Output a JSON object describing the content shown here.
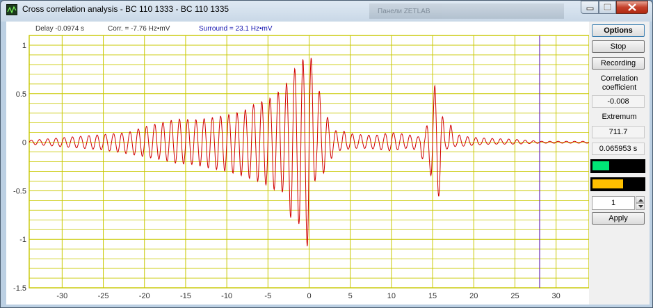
{
  "window": {
    "title": "Cross correlation analysis - BC 110 1333 - BC 110 1335",
    "background_tab": "Панели ZETLAB"
  },
  "status": {
    "delay": "Delay -0.0974 s",
    "corr": "Corr. = -7.76 Hz•mV",
    "surround": "Surround = 23.1 Hz•mV"
  },
  "side_panel": {
    "options": "Options",
    "stop": "Stop",
    "recording": "Recording",
    "corr_label": "Correlation coefficient",
    "corr_value": "-0.008",
    "extremum_label": "Extremum",
    "extremum_value": "711.7",
    "time_value": "0.065953 s",
    "indicator_green_level": 0.33,
    "indicator_yellow_level": 0.6,
    "stepper_value": "1",
    "apply": "Apply"
  },
  "colors": {
    "grid": "#c8c800",
    "signal": "#d00000",
    "cursor": "#6a2bb8",
    "indicator_green": "#00e676",
    "indicator_yellow": "#ffc000"
  },
  "icons": {
    "app": "oscilloscope-icon",
    "minimize": "minimize-icon",
    "maximize": "maximize-icon",
    "close": "close-icon"
  },
  "chart_data": {
    "type": "line",
    "title": "",
    "xlabel": "",
    "ylabel": "",
    "xlim": [
      -34,
      34
    ],
    "ylim": [
      -1.5,
      1.1
    ],
    "x_ticks": [
      -30,
      -25,
      -20,
      -15,
      -10,
      -5,
      0,
      5,
      10,
      15,
      20,
      25,
      30
    ],
    "y_ticks": [
      1,
      0.5,
      0,
      -0.5,
      -1,
      -1.5
    ],
    "cursor_x": 28,
    "grid": true,
    "series": [
      {
        "x": [
          -34,
          -31,
          -28,
          -25,
          -22,
          -20,
          -18,
          -16,
          -14,
          -12,
          -10,
          -8,
          -7,
          -6,
          -5,
          -4,
          -3,
          -2.5,
          -2,
          -1.5,
          -1,
          -0.5,
          0,
          0.5,
          1,
          2,
          3,
          4,
          5,
          6,
          8,
          10,
          12,
          13,
          14,
          14.7,
          15.3,
          16,
          16.5,
          17,
          17.5,
          18,
          19,
          20,
          22,
          25,
          28,
          34
        ],
        "y": [
          0.02,
          0.04,
          0.06,
          0.08,
          0.1,
          0.16,
          0.2,
          0.24,
          0.23,
          0.25,
          0.28,
          0.32,
          0.38,
          0.41,
          0.44,
          0.5,
          0.57,
          0.65,
          0.72,
          0.8,
          0.87,
          0.84,
          0.88,
          0.86,
          0.6,
          0.3,
          0.12,
          0.12,
          0.09,
          0.08,
          0.07,
          0.1,
          0.08,
          0.06,
          0.05,
          0.35,
          0.6,
          0.38,
          0.12,
          0.24,
          0.1,
          0.08,
          0.06,
          0.05,
          0.04,
          0.03,
          0.01,
          0.01
        ],
        "ymin": [
          -0.02,
          -0.04,
          -0.06,
          -0.08,
          -0.12,
          -0.15,
          -0.18,
          -0.22,
          -0.23,
          -0.27,
          -0.3,
          -0.35,
          -0.38,
          -0.41,
          -0.45,
          -0.5,
          -0.52,
          -0.72,
          -0.83,
          -0.75,
          -0.93,
          -0.85,
          -1.28,
          -0.55,
          -0.22,
          -0.35,
          -0.1,
          -0.08,
          -0.07,
          -0.06,
          -0.07,
          -0.09,
          -0.06,
          -0.08,
          -0.2,
          -0.3,
          -0.66,
          -0.5,
          -0.08,
          -0.06,
          -0.05,
          -0.04,
          -0.04,
          -0.03,
          -0.02,
          -0.02,
          -0.01,
          -0.01
        ]
      }
    ]
  }
}
